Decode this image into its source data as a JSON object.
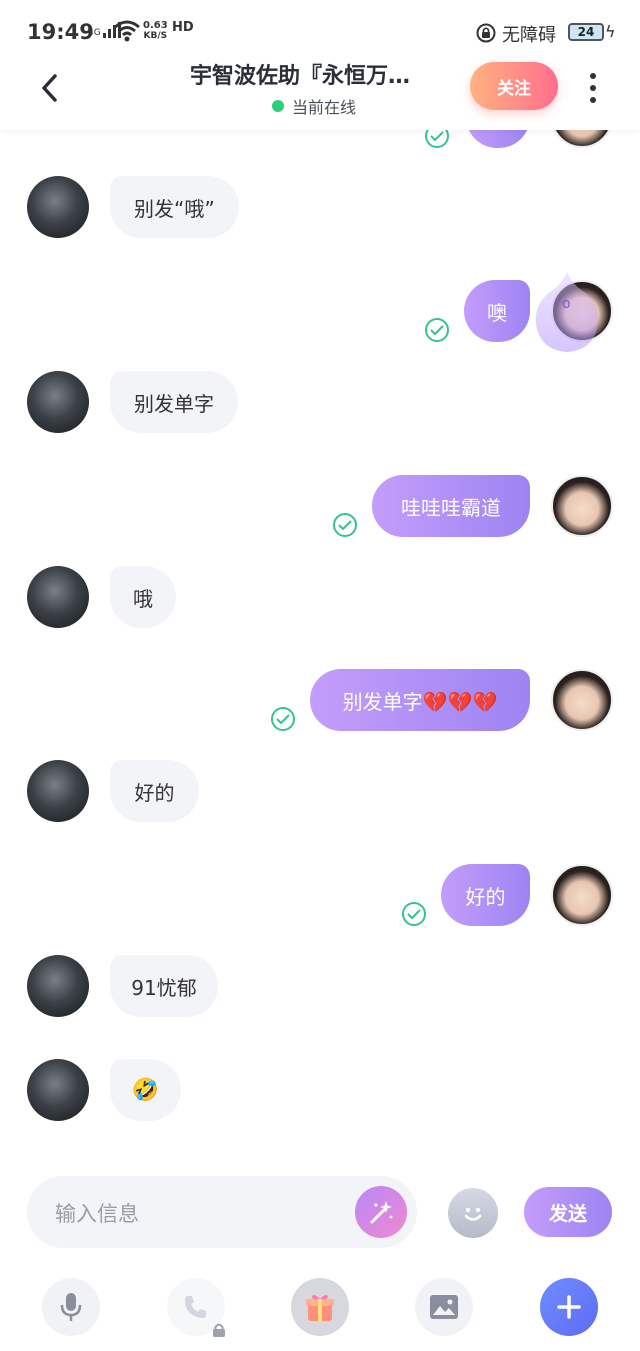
{
  "status_bar": {
    "time": "19:49",
    "network": "4G",
    "speed_value": "0.63",
    "speed_unit": "KB/S",
    "hd": "HD",
    "accessibility": "无障碍",
    "battery": "24"
  },
  "header": {
    "title": "宇智波佐助『永恒万…",
    "status": "当前在线",
    "follow_label": "关注"
  },
  "messages": [
    {
      "from": "them",
      "text": "别发“哦”"
    },
    {
      "from": "me",
      "text": "噢"
    },
    {
      "from": "them",
      "text": "别发单字"
    },
    {
      "from": "me",
      "text": "哇哇哇霸道"
    },
    {
      "from": "them",
      "text": "哦"
    },
    {
      "from": "me",
      "text": "别发单字💔💔💔"
    },
    {
      "from": "them",
      "text": "好的"
    },
    {
      "from": "me",
      "text": "好的"
    },
    {
      "from": "them",
      "text": "91忧郁"
    },
    {
      "from": "them",
      "text": "🤣"
    }
  ],
  "input": {
    "placeholder": "输入信息",
    "send_label": "发送"
  },
  "toolbar": [
    "mic-icon",
    "phone-icon",
    "gift-icon",
    "image-icon",
    "plus-icon"
  ],
  "colors": {
    "accent_purple": "#9d84f2",
    "follow_gradient": "#ff6e8e",
    "online_green": "#2bce7c",
    "read_check": "#36c489"
  }
}
